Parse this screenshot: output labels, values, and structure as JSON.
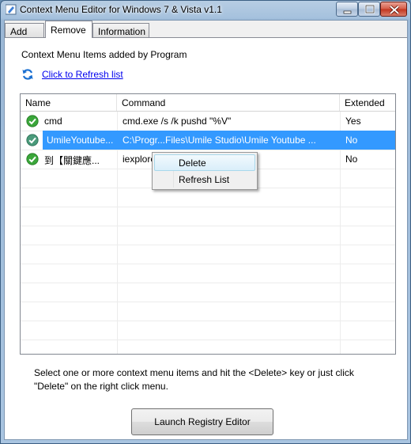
{
  "window": {
    "title": "Context Menu Editor for Windows 7 & Vista v1.1",
    "app_icon": "pen-icon",
    "controls": [
      "minimize-icon",
      "maximize-icon",
      "close-icon"
    ]
  },
  "tabs": [
    {
      "label": "Add",
      "active": false
    },
    {
      "label": "Remove",
      "active": true
    },
    {
      "label": "Information",
      "active": false
    }
  ],
  "panel": {
    "section_label": "Context Menu Items added by Program",
    "refresh_link": "Click to Refresh list",
    "refresh_icon": "refresh-icon"
  },
  "list": {
    "columns": [
      "Name",
      "Command",
      "Extended"
    ],
    "rows": [
      {
        "name": "cmd",
        "command": "cmd.exe /s /k pushd \"%V\"",
        "extended": "Yes",
        "selected": false,
        "icon": "green-check-icon"
      },
      {
        "name": "UmileYoutube...",
        "command": "C:\\Progr...Files\\Umile Studio\\Umile Youtube ...",
        "extended": "No",
        "selected": true,
        "icon": "green-check-icon"
      },
      {
        "name": "到【關鍵應...",
        "command": "iexplore.exe http://...........com",
        "extended": "No",
        "selected": false,
        "icon": "green-check-icon"
      }
    ]
  },
  "context_menu": {
    "items": [
      "Delete",
      "Refresh List"
    ],
    "highlighted": "Delete"
  },
  "help_text": "Select one or more context menu items and hit the <Delete> key or just click \"Delete\" on the right click menu.",
  "launch_button": "Launch Registry Editor",
  "colors": {
    "selection": "#3399ff",
    "link": "#0000ee",
    "check_green": "#3aa63a"
  }
}
